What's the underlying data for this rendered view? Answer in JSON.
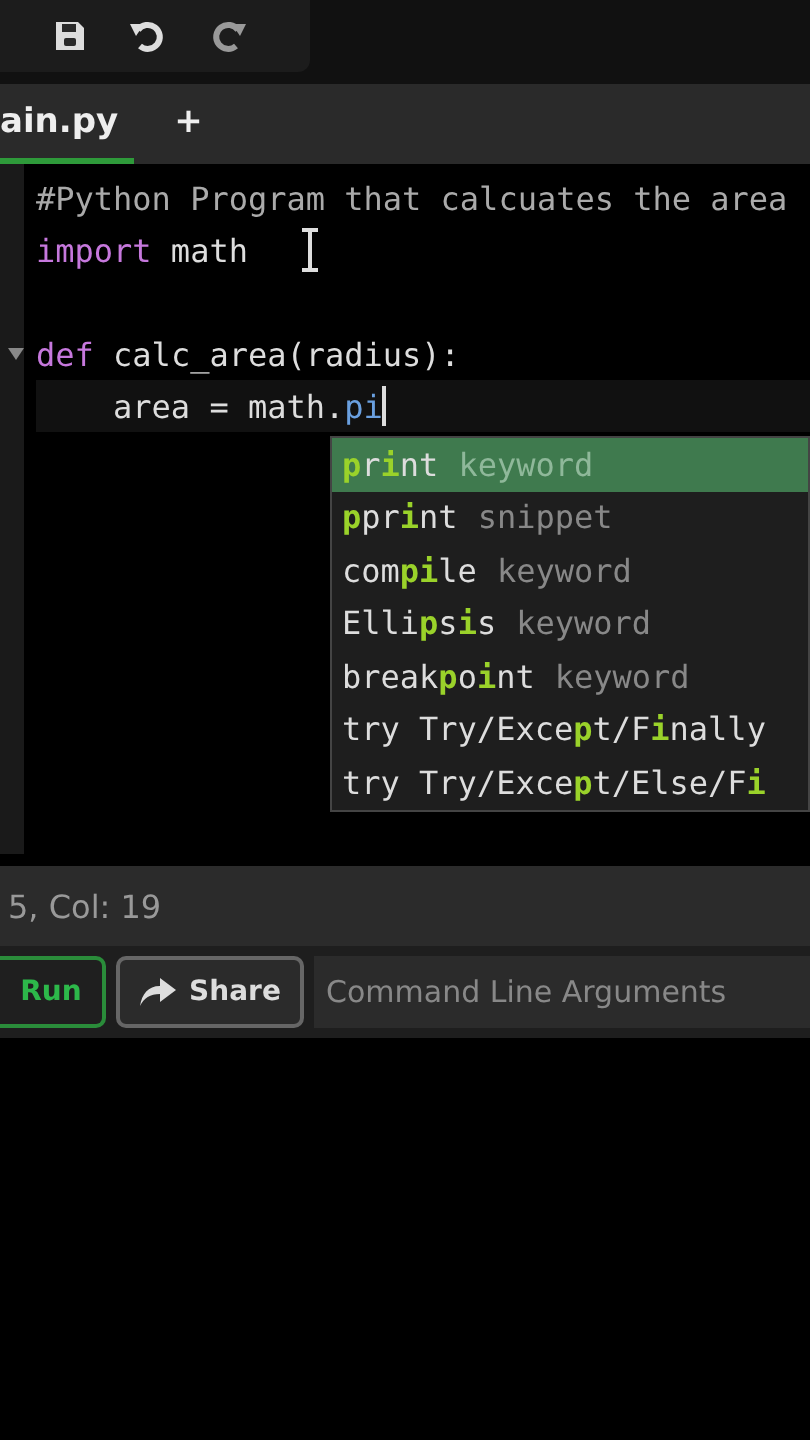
{
  "toolbar": {
    "buttons": [
      {
        "kind": "save"
      },
      {
        "kind": "undo"
      },
      {
        "kind": "redo"
      }
    ]
  },
  "tabs": [
    {
      "label": "ain.py",
      "selected": true
    },
    {
      "label": "+",
      "selected": false
    }
  ],
  "editor": {
    "lines": [
      {
        "kind": "code",
        "folded": false,
        "cursor": false,
        "tokens": [
          {
            "kind": "comment",
            "text": "#Python Program that calcuates the area"
          }
        ]
      },
      {
        "kind": "code",
        "folded": false,
        "cursor": false,
        "tokens": [
          {
            "kind": "keyword",
            "text": "import"
          },
          {
            "kind": "plain",
            "text": " math"
          }
        ]
      },
      {
        "kind": "blank"
      },
      {
        "kind": "code",
        "folded": true,
        "cursor": false,
        "tokens": [
          {
            "kind": "keyword",
            "text": "def"
          },
          {
            "kind": "plain",
            "text": " calc_area(radius):"
          }
        ]
      },
      {
        "kind": "code",
        "folded": false,
        "cursor": true,
        "tokens": [
          {
            "kind": "plain",
            "text": "    area = math."
          },
          {
            "kind": "property",
            "text": "pi"
          }
        ]
      }
    ]
  },
  "autocomplete": [
    {
      "label": "**p**r**i**nt",
      "detail": "keyword",
      "selected": true
    },
    {
      "label": "**p**pr**i**nt",
      "detail": "snippet",
      "selected": false
    },
    {
      "label": "com**pi**le",
      "detail": "keyword",
      "selected": false
    },
    {
      "label": "Elli**p**s**i**s",
      "detail": "keyword",
      "selected": false
    },
    {
      "label": "break**p**o**i**nt",
      "detail": "keyword",
      "selected": false
    },
    {
      "label": "try Try/Exce**p**t/F**i**nally",
      "selected": false
    },
    {
      "label": "try Try/Exce**p**t/Else/F**i**",
      "selected": false
    }
  ],
  "status_bar": {
    "position": "5,  Col: 19"
  },
  "actions": {
    "run": "Run",
    "share": "Share",
    "arguments": {
      "placeholder": "Command Line Arguments"
    }
  }
}
